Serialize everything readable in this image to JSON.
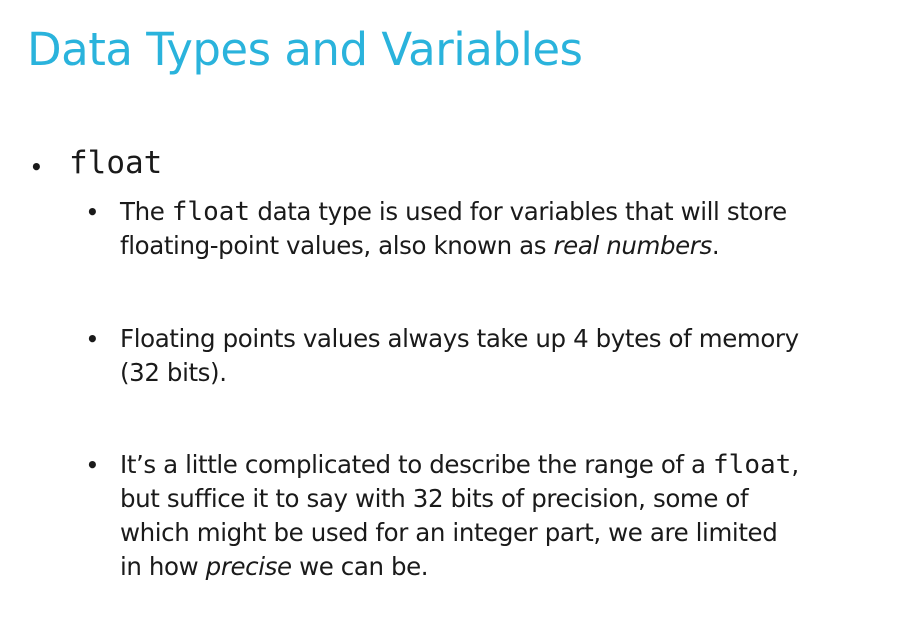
{
  "slide": {
    "title": "Data Types and Variables"
  },
  "bullets": {
    "top": {
      "marker": "•",
      "code": "float"
    },
    "items": [
      {
        "marker": "•",
        "line1_pre": "The ",
        "line1_code": "float",
        "line1_post": " data type is used for variables that will store",
        "line2_pre": "floating-point values, also known as ",
        "line2_em": "real numbers",
        "line2_post": "."
      },
      {
        "marker": "•",
        "line1": "Floating points values always take up 4 bytes of memory",
        "line2": "(32 bits)."
      },
      {
        "marker": "•",
        "line1_pre": "It’s a little complicated to describe the range of a ",
        "line1_code": "float",
        "line1_post": ",",
        "line2": "but suffice it to say with 32 bits of precision, some of",
        "line3": "which might be used for an integer part, we are limited",
        "line4_pre": "in how ",
        "line4_em": "precise",
        "line4_post": " we can be."
      }
    ]
  }
}
